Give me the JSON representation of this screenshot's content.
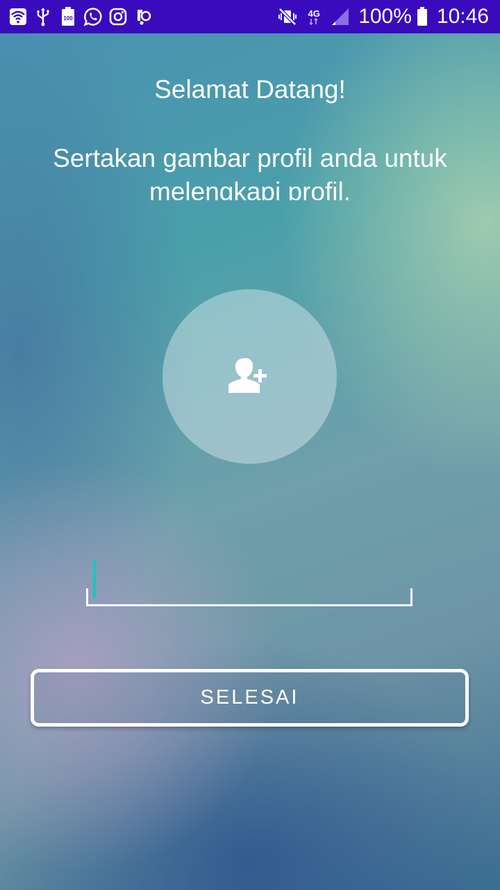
{
  "status_bar": {
    "background": "#3a0bbd",
    "left_icons": [
      "wifi-icon",
      "usb-icon",
      "battery-saver-icon",
      "whatsapp-icon",
      "instagram-icon",
      "app-notification-icon"
    ],
    "battery_saver_label": "100",
    "network_type": "4G",
    "right_icons": [
      "vibrate-off-icon",
      "signal-icon",
      "battery-icon"
    ],
    "battery_percent": "100%",
    "time": "10:46"
  },
  "header": {
    "title": "Selamat Datang!",
    "subtitle": "Sertakan gambar profil anda untuk melengkapi profil."
  },
  "avatar": {
    "icon": "add-user-icon"
  },
  "name_input": {
    "value": "",
    "cursor_color": "#18c7c0"
  },
  "actions": {
    "done_label": "SELESAI"
  }
}
